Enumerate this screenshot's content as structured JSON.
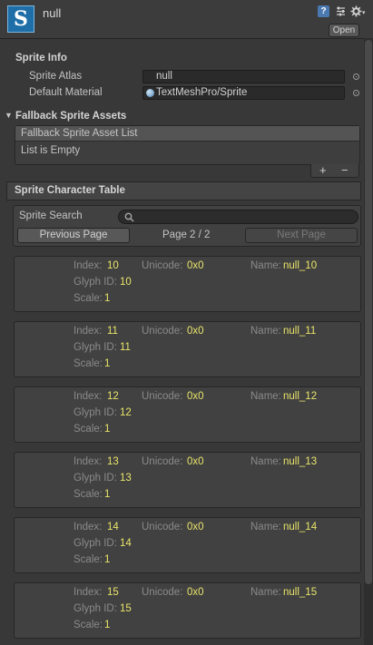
{
  "header": {
    "title": "null",
    "logo_letter": "S",
    "help_icon": "help-icon",
    "open_label": "Open"
  },
  "sprite_info": {
    "heading": "Sprite Info",
    "atlas_label": "Sprite Atlas",
    "atlas_value": "null",
    "material_label": "Default Material",
    "material_value": "TextMeshPro/Sprite"
  },
  "fallback": {
    "heading": "Fallback Sprite Assets",
    "list_title": "Fallback Sprite Asset List",
    "empty_text": "List is Empty",
    "add_label": "+",
    "remove_label": "−"
  },
  "table": {
    "heading": "Sprite Character Table",
    "search_label": "Sprite Search",
    "prev_label": "Previous Page",
    "page_text": "Page 2 / 2",
    "next_label": "Next Page",
    "labels": {
      "index": "Index:",
      "unicode": "Unicode:",
      "name": "Name:",
      "glyph": "Glyph ID:",
      "scale": "Scale:"
    },
    "rows": [
      {
        "index": "10",
        "unicode": "0x0",
        "name": "null_10",
        "glyph": "10",
        "scale": "1"
      },
      {
        "index": "11",
        "unicode": "0x0",
        "name": "null_11",
        "glyph": "11",
        "scale": "1"
      },
      {
        "index": "12",
        "unicode": "0x0",
        "name": "null_12",
        "glyph": "12",
        "scale": "1"
      },
      {
        "index": "13",
        "unicode": "0x0",
        "name": "null_13",
        "glyph": "13",
        "scale": "1"
      },
      {
        "index": "14",
        "unicode": "0x0",
        "name": "null_14",
        "glyph": "14",
        "scale": "1"
      },
      {
        "index": "15",
        "unicode": "0x0",
        "name": "null_15",
        "glyph": "15",
        "scale": "1"
      }
    ]
  }
}
